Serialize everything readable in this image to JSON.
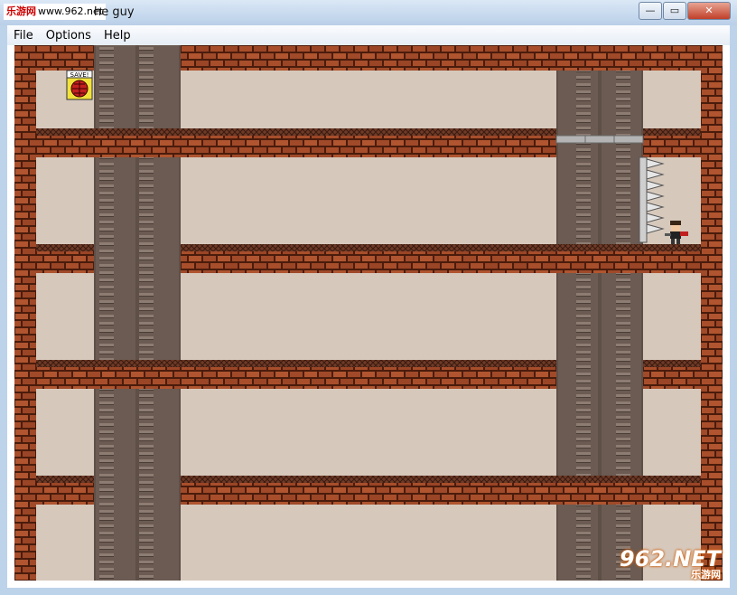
{
  "window": {
    "title": "he guy",
    "watermark_text": "www.962.net",
    "watermark_tag": "乐游网",
    "controls": [
      "—",
      "▭",
      "✕"
    ]
  },
  "menu": [
    "File",
    "Options",
    "Help"
  ],
  "game": {
    "save_label": "SAVE!",
    "colors": {
      "background": "#d6c9bc",
      "brick": "#a24c2a",
      "mortar": "#4a1c0c",
      "pillar": "#6b5b52",
      "ladder": "#8a7a70",
      "spike": "#c8c8c8",
      "player_shirt": "#222222",
      "player_cape": "#c02020"
    }
  },
  "logo": {
    "big": "962.NET",
    "small": "乐游网"
  }
}
